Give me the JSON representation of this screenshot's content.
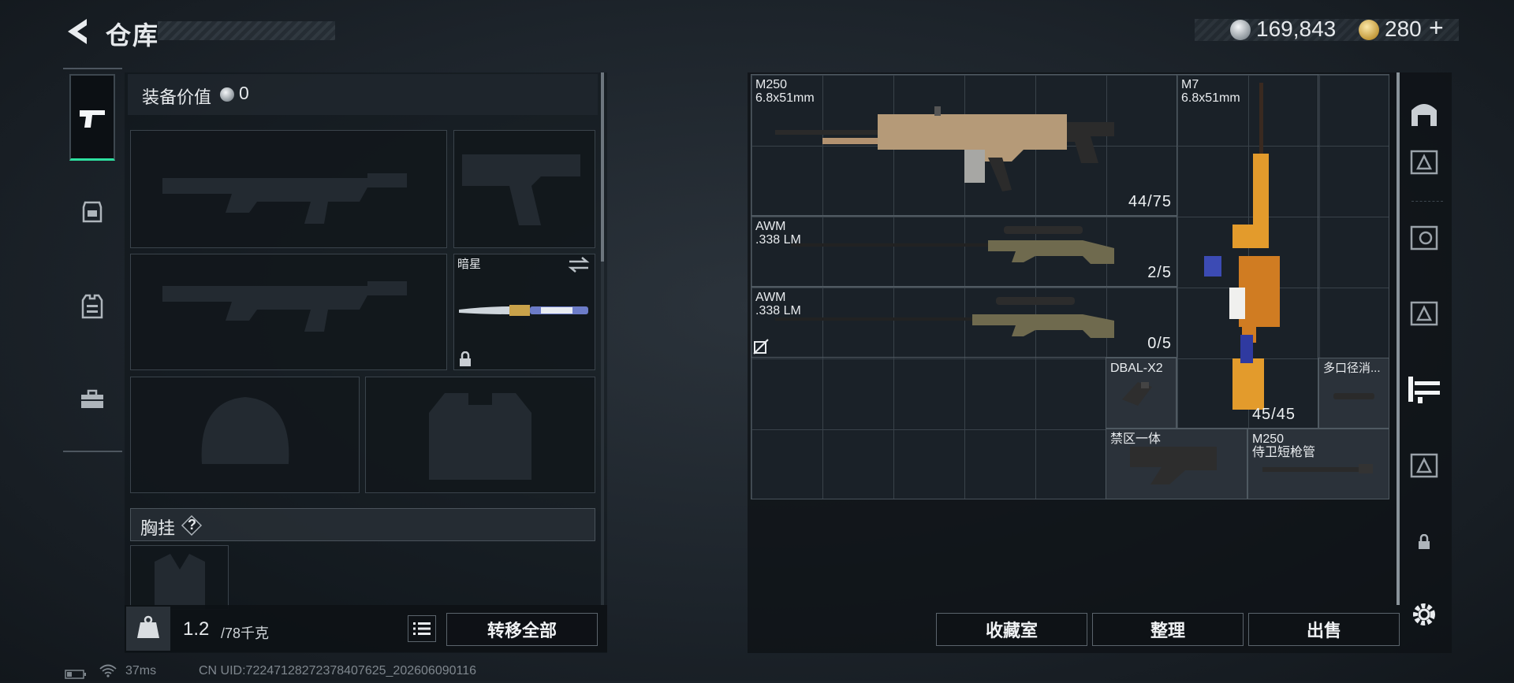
{
  "header": {
    "title": "仓库",
    "currency": {
      "silver": "169,843",
      "gold": "280",
      "add_symbol": "+"
    }
  },
  "loadout": {
    "value_label": "装备价值",
    "value_amount": "0",
    "melee_name": "暗星",
    "chest_label": "胸挂",
    "chest_help": "?",
    "weight_current": "1.2",
    "weight_capacity": "/78千克",
    "transfer_all_label": "转移全部"
  },
  "nav_tabs": [
    {
      "name": "weapons",
      "icon": "pistol-icon",
      "active": true
    },
    {
      "name": "helmet",
      "icon": "helmet-icon"
    },
    {
      "name": "vest",
      "icon": "vest-icon"
    },
    {
      "name": "case",
      "icon": "briefcase-icon"
    }
  ],
  "stash": {
    "items": [
      {
        "id": "m250-lmg",
        "name": "M250",
        "caliber": "6.8x51mm",
        "ammo": "44/75"
      },
      {
        "id": "m7",
        "name": "M7",
        "caliber": "6.8x51mm",
        "ammo": "45/45"
      },
      {
        "id": "awm1",
        "name": "AWM",
        "caliber": ".338 LM",
        "ammo": "2/5"
      },
      {
        "id": "awm2",
        "name": "AWM",
        "caliber": ".338 LM",
        "ammo": "0/5"
      },
      {
        "id": "dbal",
        "name": "DBAL-X2"
      },
      {
        "id": "suppressor",
        "name": "多口径消..."
      },
      {
        "id": "stock",
        "name": "禁区一体"
      },
      {
        "id": "m250-barrel",
        "name": "M250",
        "subname": "侍卫短枪管"
      }
    ]
  },
  "actions": {
    "favorites": "收藏室",
    "sort": "整理",
    "sell": "出售"
  },
  "status": {
    "ping": "37ms",
    "uid": "CN UID:7224712827237840762​5_202606090116"
  },
  "colors": {
    "accent": "#2ee0a0",
    "panel": "#1a2128",
    "grid_line": "#39424a"
  }
}
